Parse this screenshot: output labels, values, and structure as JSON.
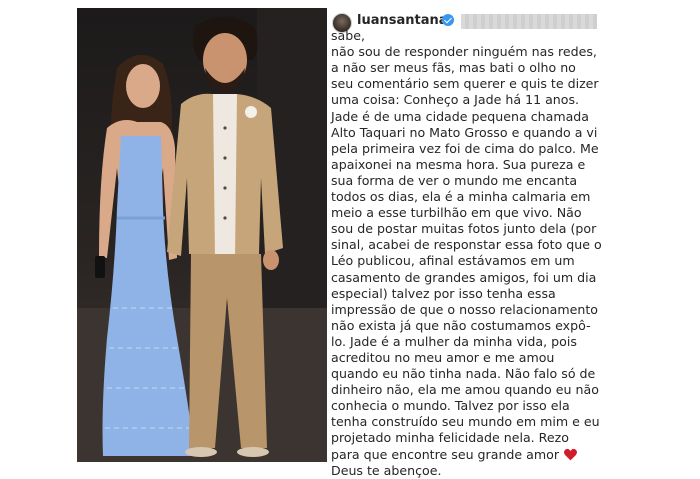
{
  "post": {
    "username": "luansantana",
    "verified": true,
    "caption_lines": [
      "sabe,",
      "não sou de responder ninguém nas redes,",
      "a não ser meus fãs, mas bati o olho no",
      "seu comentário sem querer e quis te dizer",
      "uma coisa: Conheço a Jade há 11 anos.",
      "Jade é de uma cidade pequena chamada",
      "Alto Taquari no Mato Grosso e quando a vi",
      "pela primeira vez foi de cima do palco. Me",
      "apaixonei na mesma hora. Sua pureza e",
      "sua forma de ver o mundo me encanta",
      "todos os dias, ela é a minha calmaria em",
      "meio a esse turbilhão em que vivo. Não",
      "sou de postar muitas fotos junto dela (por",
      "sinal, acabei de responstar essa foto que o",
      "Léo publicou, afinal estávamos em um",
      "casamento de grandes amigos, foi um dia",
      "especial) talvez por isso tenha essa",
      "impressão de que o nosso relacionamento",
      "não exista já que não costumamos expô-",
      "lo. Jade é a mulher da minha vida, pois",
      "acreditou no meu amor e me amou",
      "quando eu não tinha nada. Não falo só de",
      "dinheiro não, ela me amou quando eu não",
      "conhecia o mundo. Talvez por isso ela",
      "tenha construído seu mundo em mim e eu",
      "projetado minha felicidade nela. Rezo",
      "para que encontre seu grande amor",
      "Deus te abençoe."
    ],
    "heart_icon": "red-heart-emoji"
  },
  "colors": {
    "text": "#262626",
    "verified": "#3897f0",
    "heart": "#d11a2a",
    "dress": "#8fb3e6",
    "suit": "#c6a57a"
  }
}
